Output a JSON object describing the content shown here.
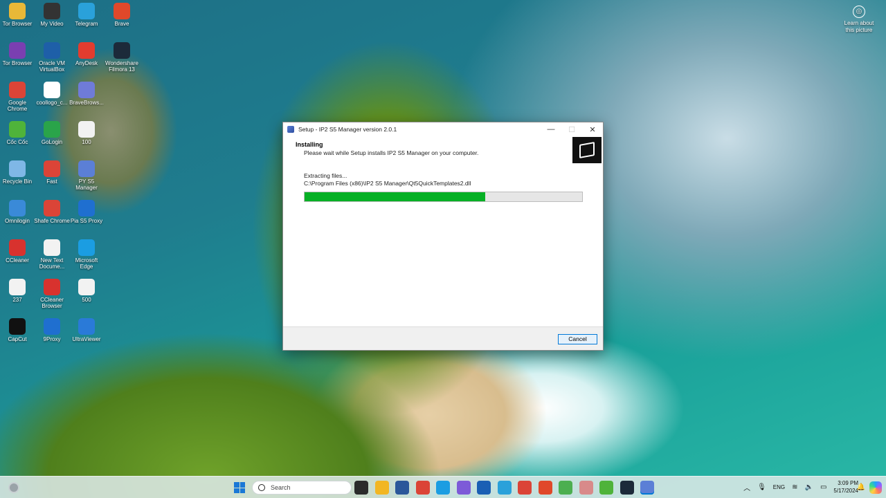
{
  "desktop": {
    "icons": [
      {
        "label": "Tor Browser",
        "icon": "folder-icon",
        "color": "#e8b838"
      },
      {
        "label": "My Video",
        "icon": "video-icon",
        "color": "#333333"
      },
      {
        "label": "Telegram",
        "icon": "telegram-icon",
        "color": "#2aa1da"
      },
      {
        "label": "Brave",
        "icon": "brave-icon",
        "color": "#e0482a"
      },
      {
        "label": "Tor Browser",
        "icon": "tor-icon",
        "color": "#7a3fb1"
      },
      {
        "label": "Oracle VM VirtualBox",
        "icon": "virtualbox-icon",
        "color": "#1e5fa8"
      },
      {
        "label": "AnyDesk",
        "icon": "anydesk-icon",
        "color": "#e23c2f"
      },
      {
        "label": "Wondershare Filmora 13",
        "icon": "filmora-icon",
        "color": "#1c2a3a"
      },
      {
        "label": "Google Chrome",
        "icon": "chrome-icon",
        "color": "#db4437"
      },
      {
        "label": "coollogo_c...",
        "icon": "image-icon",
        "color": "#ffffff"
      },
      {
        "label": "BraveBrows...",
        "icon": "app-icon",
        "color": "#6f7bd8"
      },
      {
        "label": "Cốc Cốc",
        "icon": "coccoc-icon",
        "color": "#4fb33a"
      },
      {
        "label": "GoLogin",
        "icon": "gologin-icon",
        "color": "#2aa44a"
      },
      {
        "label": "100",
        "icon": "file-icon",
        "color": "#f2f2f2"
      },
      {
        "label": "Recycle Bin",
        "icon": "recycle-bin-icon",
        "color": "#7fb7e6"
      },
      {
        "label": "Fast",
        "icon": "chrome-icon",
        "color": "#db4437"
      },
      {
        "label": "PY S5 Manager",
        "icon": "app-icon",
        "color": "#5b7fd6"
      },
      {
        "label": "Omnilogin",
        "icon": "omnilogin-icon",
        "color": "#3a8ad8"
      },
      {
        "label": "Shafe Chrome",
        "icon": "chrome-icon",
        "color": "#db4437"
      },
      {
        "label": "Pia S5 Proxy",
        "icon": "proxy-icon",
        "color": "#1f6fd0"
      },
      {
        "label": "CCleaner",
        "icon": "ccleaner-icon",
        "color": "#d8322e"
      },
      {
        "label": "New Text Docume...",
        "icon": "text-file-icon",
        "color": "#f2f2f2"
      },
      {
        "label": "Microsoft Edge",
        "icon": "edge-icon",
        "color": "#1b9de2"
      },
      {
        "label": "237",
        "icon": "file-icon",
        "color": "#f2f2f2"
      },
      {
        "label": "CCleaner Browser",
        "icon": "ccleaner-browser-icon",
        "color": "#d8322e"
      },
      {
        "label": "500",
        "icon": "file-icon",
        "color": "#f2f2f2"
      },
      {
        "label": "CapCut",
        "icon": "capcut-icon",
        "color": "#111111"
      },
      {
        "label": "9Proxy",
        "icon": "proxy-icon",
        "color": "#1f6fd0"
      },
      {
        "label": "UltraViewer",
        "icon": "ultraviewer-icon",
        "color": "#2a7ad8"
      }
    ],
    "learn_about": "Learn about this picture"
  },
  "window": {
    "title": "Setup - IP2 S5 Manager version 2.0.1",
    "heading": "Installing",
    "subheading": "Please wait while Setup installs IP2 S5 Manager on your computer.",
    "status": "Extracting files...",
    "file_path": "C:\\Program Files (x86)\\IP2 S5 Manager\\Qt5QuickTemplates2.dll",
    "progress": 0.65,
    "progress_color": "#06b025",
    "cancel_label": "Cancel",
    "minimize_glyph": "—",
    "maximize_glyph": "☐",
    "close_glyph": "✕"
  },
  "taskbar": {
    "search_placeholder": "Search",
    "apps": [
      {
        "name": "file-explorer-dark",
        "color": "#2b2b2b"
      },
      {
        "name": "file-explorer",
        "color": "#f2b622"
      },
      {
        "name": "word-app",
        "color": "#2b579a"
      },
      {
        "name": "chrome",
        "color": "#db4437"
      },
      {
        "name": "edge",
        "color": "#1b9de2"
      },
      {
        "name": "snipping-tool",
        "color": "#7d5ad8"
      },
      {
        "name": "pdf-app",
        "color": "#1a5fb4"
      },
      {
        "name": "telegram",
        "color": "#2aa1da"
      },
      {
        "name": "chrome-profile",
        "color": "#db4437"
      },
      {
        "name": "brave",
        "color": "#e0482a"
      },
      {
        "name": "notepad",
        "color": "#4caf50"
      },
      {
        "name": "web-app",
        "color": "#d88a8a"
      },
      {
        "name": "coccoc",
        "color": "#4fb33a"
      },
      {
        "name": "filmora",
        "color": "#1c2a3a"
      },
      {
        "name": "setup-installer",
        "color": "#5b7fd6"
      }
    ],
    "tray": {
      "language": "ENG",
      "time": "3:09 PM",
      "date": "5/17/2024"
    }
  }
}
